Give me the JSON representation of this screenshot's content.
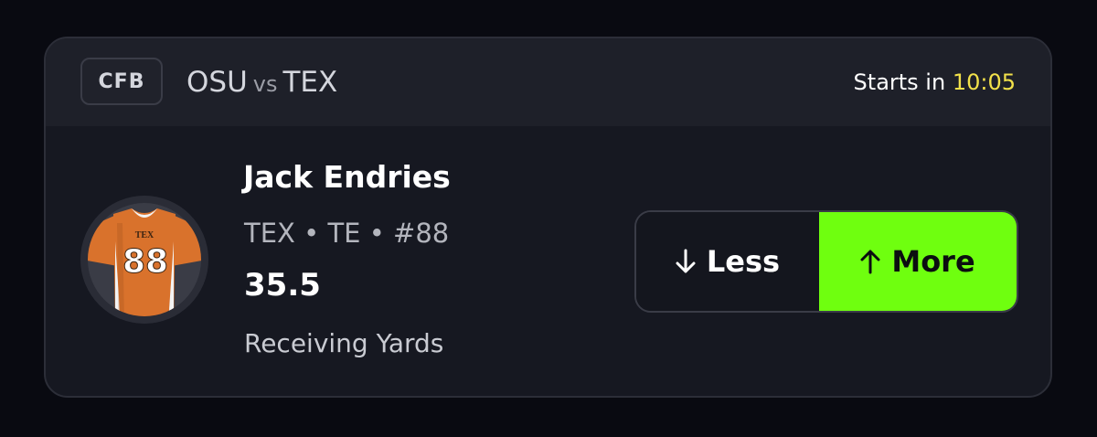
{
  "header": {
    "league": "CFB",
    "team_away": "OSU",
    "vs_label": "vs",
    "team_home": "TEX",
    "starts_label": "Starts in",
    "countdown": "10:05"
  },
  "player": {
    "name": "Jack Endries",
    "meta": "TEX • TE • #88",
    "jersey_text": "TEX",
    "jersey_number": "88"
  },
  "projection": {
    "line": "35.5",
    "stat": "Receiving Yards"
  },
  "picks": {
    "less_label": "Less",
    "more_label": "More",
    "selected": "More"
  },
  "icons": {
    "less": "arrow-down-icon",
    "more": "arrow-up-icon"
  },
  "colors": {
    "countdown": "#f2e14a",
    "more_selected": "#6fff0f",
    "jersey": "#d9722c"
  }
}
